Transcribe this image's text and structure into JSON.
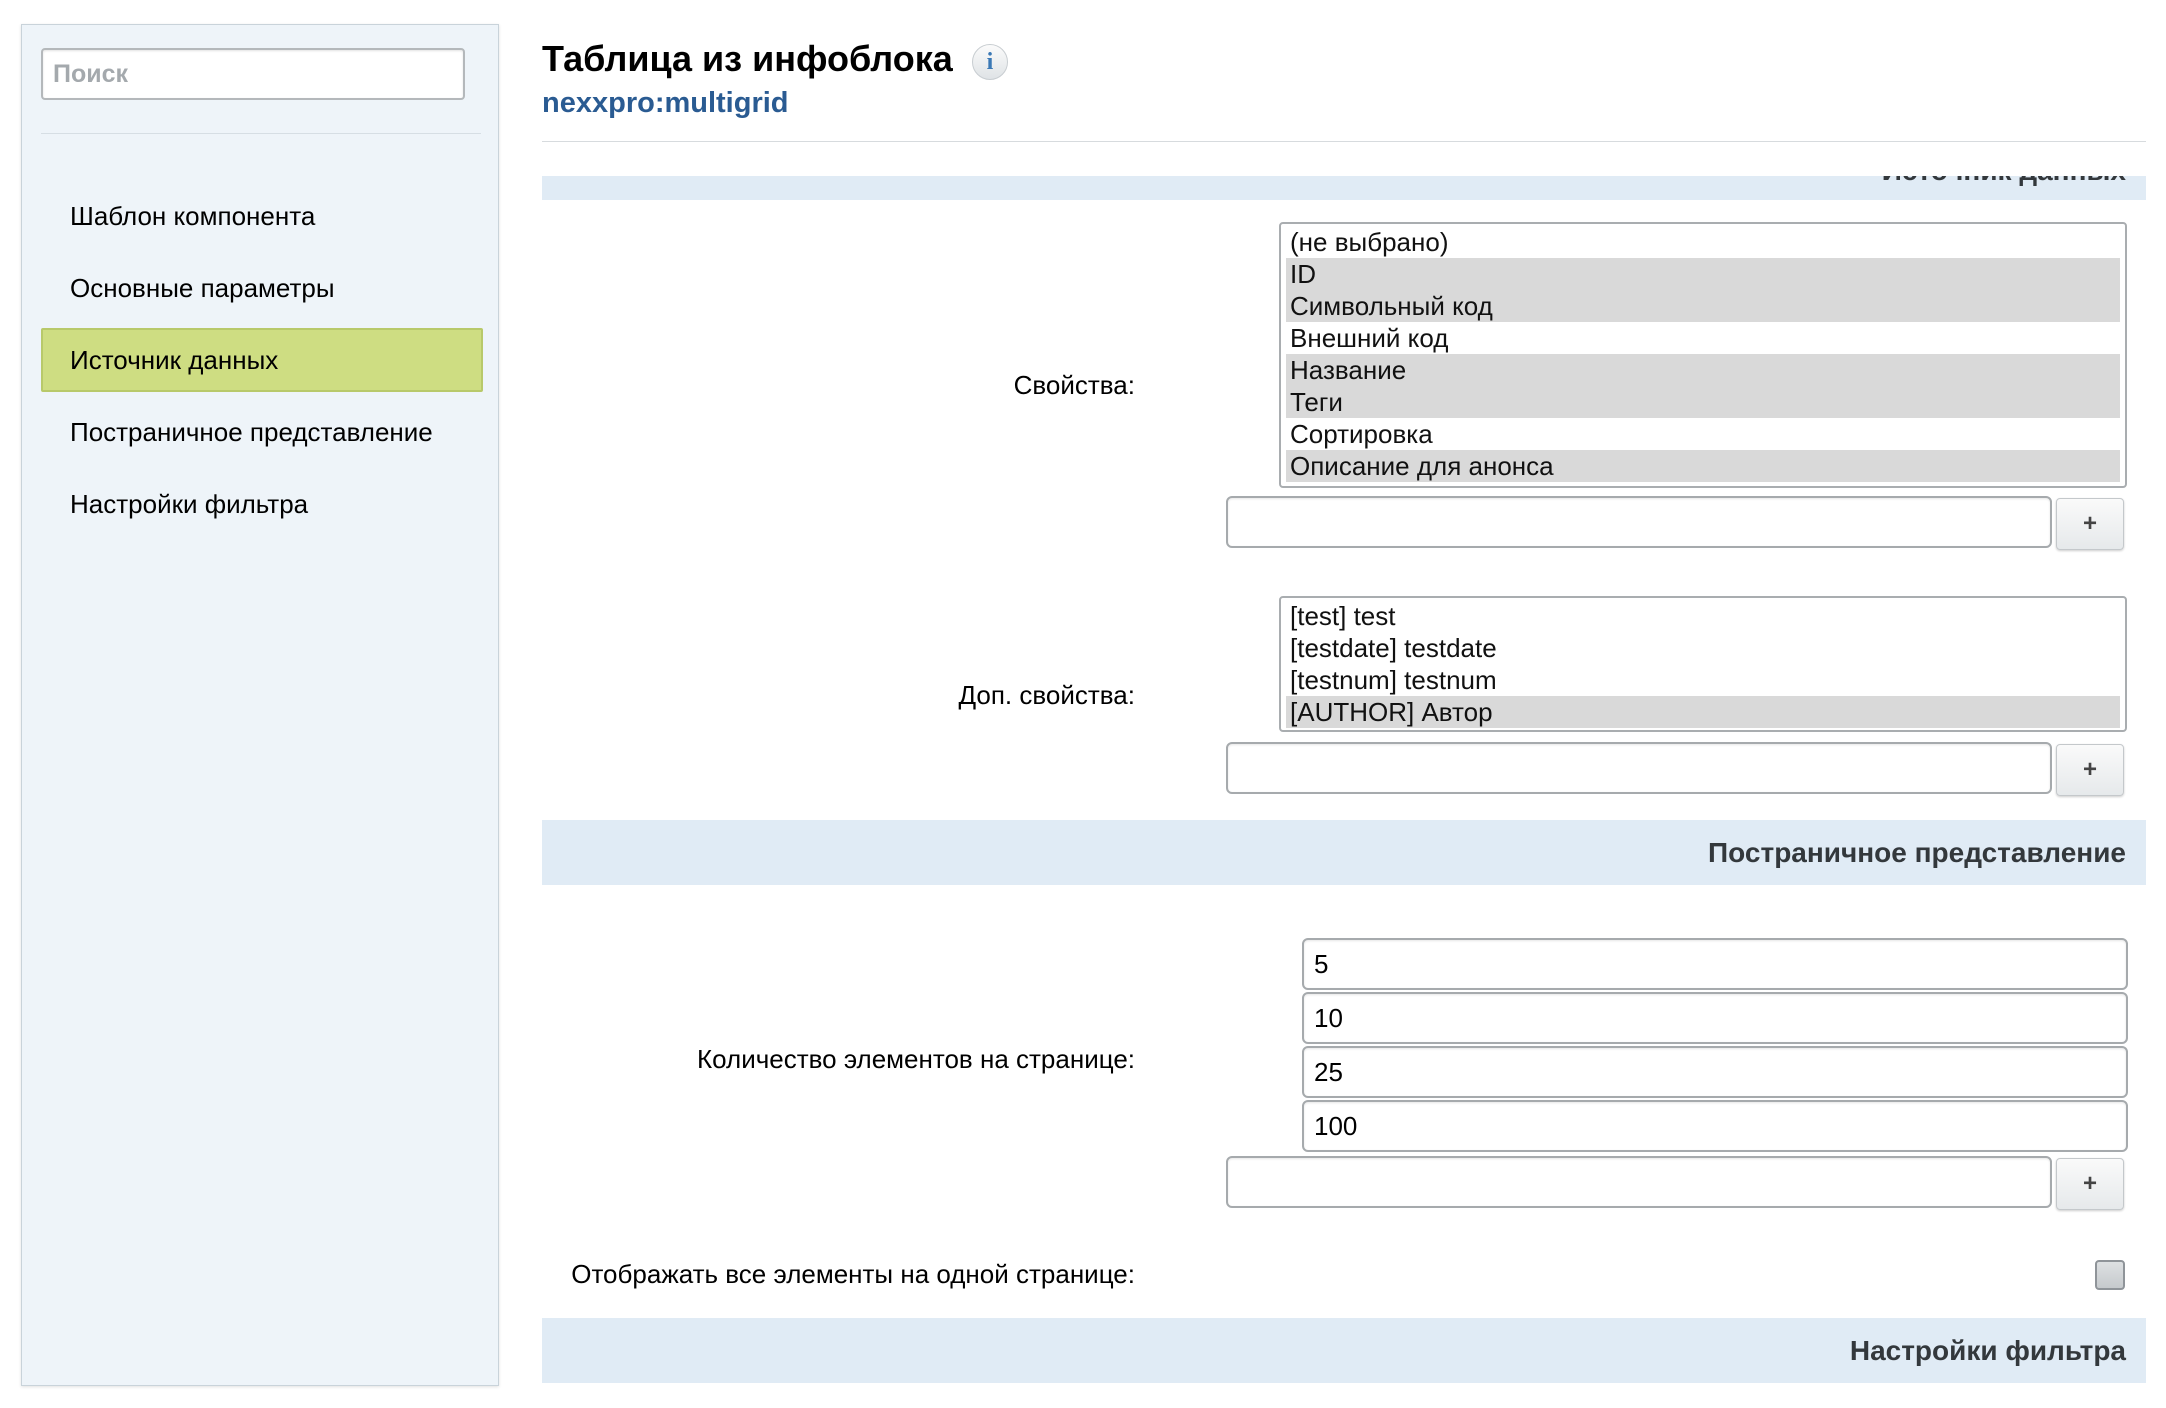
{
  "sidebar": {
    "search_placeholder": "Поиск",
    "items": [
      {
        "label": "Шаблон компонента"
      },
      {
        "label": "Основные параметры"
      },
      {
        "label": "Источник данных",
        "active": true
      },
      {
        "label": "Постраничное представление"
      },
      {
        "label": "Настройки фильтра"
      }
    ]
  },
  "header": {
    "title": "Таблица из инфоблока",
    "info_icon": "i",
    "subtitle": "nexxpro:multigrid"
  },
  "sections": {
    "data_source": "Источник данных",
    "paging": "Постраничное представление",
    "filter": "Настройки фильтра"
  },
  "properties": {
    "label": "Свойства:",
    "options": [
      {
        "text": "(не выбрано)",
        "selected": false
      },
      {
        "text": "ID",
        "selected": true
      },
      {
        "text": "Символьный код",
        "selected": true
      },
      {
        "text": "Внешний код",
        "selected": false
      },
      {
        "text": "Название",
        "selected": true
      },
      {
        "text": "Теги",
        "selected": true
      },
      {
        "text": "Сортировка",
        "selected": false
      },
      {
        "text": "Описание для анонса",
        "selected": true
      }
    ],
    "input_value": "",
    "add_label": "+"
  },
  "extra_properties": {
    "label": "Доп. свойства:",
    "options": [
      {
        "text": "[test] test",
        "selected": false
      },
      {
        "text": "[testdate] testdate",
        "selected": false
      },
      {
        "text": "[testnum] testnum",
        "selected": false
      },
      {
        "text": "[AUTHOR] Автор",
        "selected": true
      }
    ],
    "input_value": "",
    "add_label": "+"
  },
  "page_size": {
    "label": "Количество элементов на странице:",
    "values": [
      "5",
      "10",
      "25",
      "100"
    ],
    "input_value": "",
    "add_label": "+"
  },
  "show_all": {
    "label": "Отображать все элементы на одной странице:",
    "checked": false
  },
  "colors": {
    "active_nav": "#cedd82",
    "section_bar": "#e0ebf5",
    "link": "#2a5b92",
    "selected_option": "#d9d9d9"
  }
}
